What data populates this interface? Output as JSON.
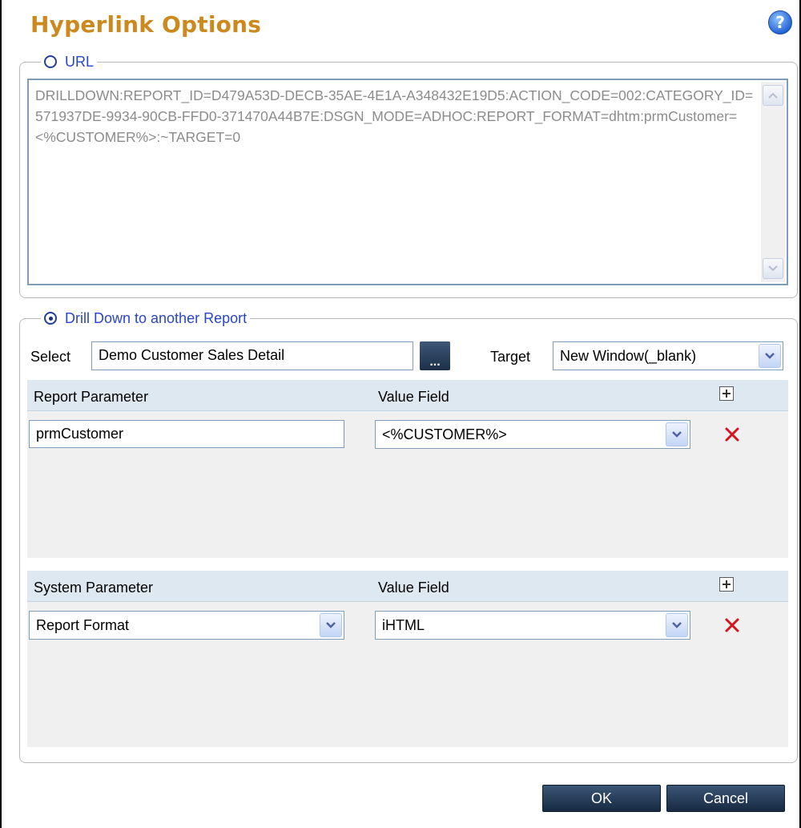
{
  "dialog": {
    "title": "Hyperlink Options"
  },
  "url_section": {
    "legend": "URL",
    "selected": false,
    "url_text": "DRILLDOWN:REPORT_ID=D479A53D-DECB-35AE-4E1A-A348432E19D5:ACTION_CODE=002:CATEGORY_ID=571937DE-9934-90CB-FFD0-371470A44B7E:DSGN_MODE=ADHOC:REPORT_FORMAT=dhtm:prmCustomer=<%CUSTOMER%>:~TARGET=0"
  },
  "drilldown_section": {
    "legend": "Drill Down to another Report",
    "selected": true,
    "select_label": "Select",
    "select_value": "Demo Customer Sales Detail",
    "browse_label": "...",
    "target_label": "Target",
    "target_value": "New Window(_blank)"
  },
  "report_params": {
    "col_param": "Report Parameter",
    "col_value": "Value Field",
    "rows": [
      {
        "param": "prmCustomer",
        "value": "<%CUSTOMER%>"
      }
    ]
  },
  "system_params": {
    "col_param": "System Parameter",
    "col_value": "Value Field",
    "rows": [
      {
        "param": "Report Format",
        "value": "iHTML"
      }
    ]
  },
  "buttons": {
    "ok": "OK",
    "cancel": "Cancel"
  },
  "icons": {
    "help": "help-icon",
    "add": "add-row-icon",
    "delete": "delete-row-icon",
    "dropdown": "chevron-down-icon"
  },
  "colors": {
    "title": "#cc8a1e",
    "legend": "#2a46c8",
    "delete": "#d3161e",
    "button": "#233a58"
  }
}
